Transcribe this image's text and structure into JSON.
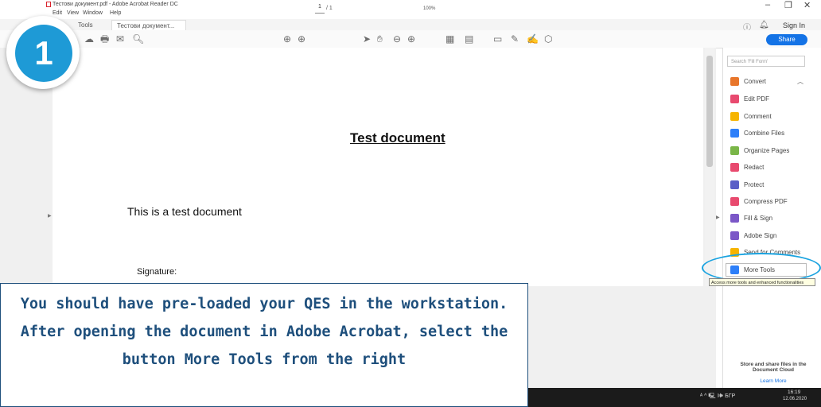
{
  "window": {
    "title": "Тестови документ.pdf - Adobe Acrobat Reader DC",
    "menu": [
      "Edit",
      "View",
      "Window",
      "Help"
    ],
    "controls": [
      "–",
      "❐",
      "✕"
    ]
  },
  "tabs": {
    "tools": "Tools",
    "document": "Тестови документ...",
    "close": "×"
  },
  "header_right": {
    "sign_in": "Sign In",
    "share": "Share"
  },
  "toolbar": {
    "page_current": "1",
    "page_total": "/ 1",
    "zoom": "100%"
  },
  "document": {
    "title": "Test document",
    "body": "This is a test document",
    "signature_label": "Signature:"
  },
  "tool_pane": {
    "search_placeholder": "Search 'Fill Form'",
    "items": [
      {
        "label": "Convert",
        "color": "#e8762b"
      },
      {
        "label": "Edit PDF",
        "color": "#e84a6f"
      },
      {
        "label": "Comment",
        "color": "#f6b400"
      },
      {
        "label": "Combine Files",
        "color": "#2d7ff9"
      },
      {
        "label": "Organize Pages",
        "color": "#7ab648"
      },
      {
        "label": "Redact",
        "color": "#e84a6f"
      },
      {
        "label": "Protect",
        "color": "#5b5fc7"
      },
      {
        "label": "Compress PDF",
        "color": "#e84a6f"
      },
      {
        "label": "Fill & Sign",
        "color": "#7b57c7"
      },
      {
        "label": "Adobe Sign",
        "color": "#7b57c7"
      },
      {
        "label": "Send for Comments",
        "color": "#f6b400"
      },
      {
        "label": "More Tools",
        "color": "#2d7ff9"
      }
    ],
    "tooltip": "Access more tools and enhanced functionalities",
    "cloud_title": "Store and share files in the Document Cloud",
    "cloud_link": "Learn More"
  },
  "taskbar": {
    "tray": "ᴬ ^ 🖳 🕪 БГР",
    "time": "16:19",
    "date": "12.06.2020"
  },
  "overlay": {
    "step_number": "1",
    "instruction": "You should have pre-loaded your QES in the workstation. After opening the document in Adobe Acrobat, select the button More Tools from the right"
  },
  "colors": {
    "accent": "#1473e6",
    "badge": "#1e9ad6",
    "instruction_text": "#1e4f7c"
  }
}
